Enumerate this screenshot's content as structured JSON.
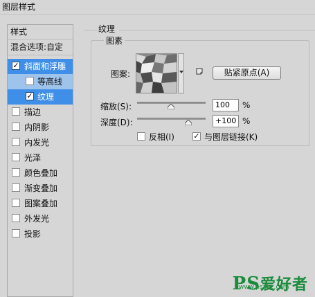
{
  "window": {
    "title": "图层样式"
  },
  "left_panel": {
    "header": "样式",
    "blend_options": "混合选项:自定",
    "items": [
      {
        "label": "斜面和浮雕",
        "checked": true
      },
      {
        "label": "等高线",
        "checked": false
      },
      {
        "label": "纹理",
        "checked": true
      },
      {
        "label": "描边",
        "checked": false
      },
      {
        "label": "内阴影",
        "checked": false
      },
      {
        "label": "内发光",
        "checked": false
      },
      {
        "label": "光泽",
        "checked": false
      },
      {
        "label": "颜色叠加",
        "checked": false
      },
      {
        "label": "渐变叠加",
        "checked": false
      },
      {
        "label": "图案叠加",
        "checked": false
      },
      {
        "label": "外发光",
        "checked": false
      },
      {
        "label": "投影",
        "checked": false
      }
    ]
  },
  "texture": {
    "group_title": "纹理",
    "fieldset_title": "图素",
    "pattern_label": "图案:",
    "snap_button": "贴紧原点(A)",
    "scale_label": "缩放(S):",
    "scale_value": "100",
    "scale_unit": "%",
    "depth_label": "深度(D):",
    "depth_value": "+100",
    "depth_unit": "%",
    "invert_label": "反相(I)",
    "invert_checked": false,
    "link_label": "与图层链接(K)",
    "link_checked": true
  },
  "watermark": {
    "brand": "PS",
    "text": "爱好者",
    "url": "www.psahz.com"
  },
  "colors": {
    "selected": "#3f8fe8",
    "sub_selected": "#9fc4ec",
    "background": "#d6d6d6"
  },
  "icons": [
    "check-icon",
    "dropdown-arrow-icon",
    "new-preset-icon",
    "slider-thumb-icon"
  ]
}
